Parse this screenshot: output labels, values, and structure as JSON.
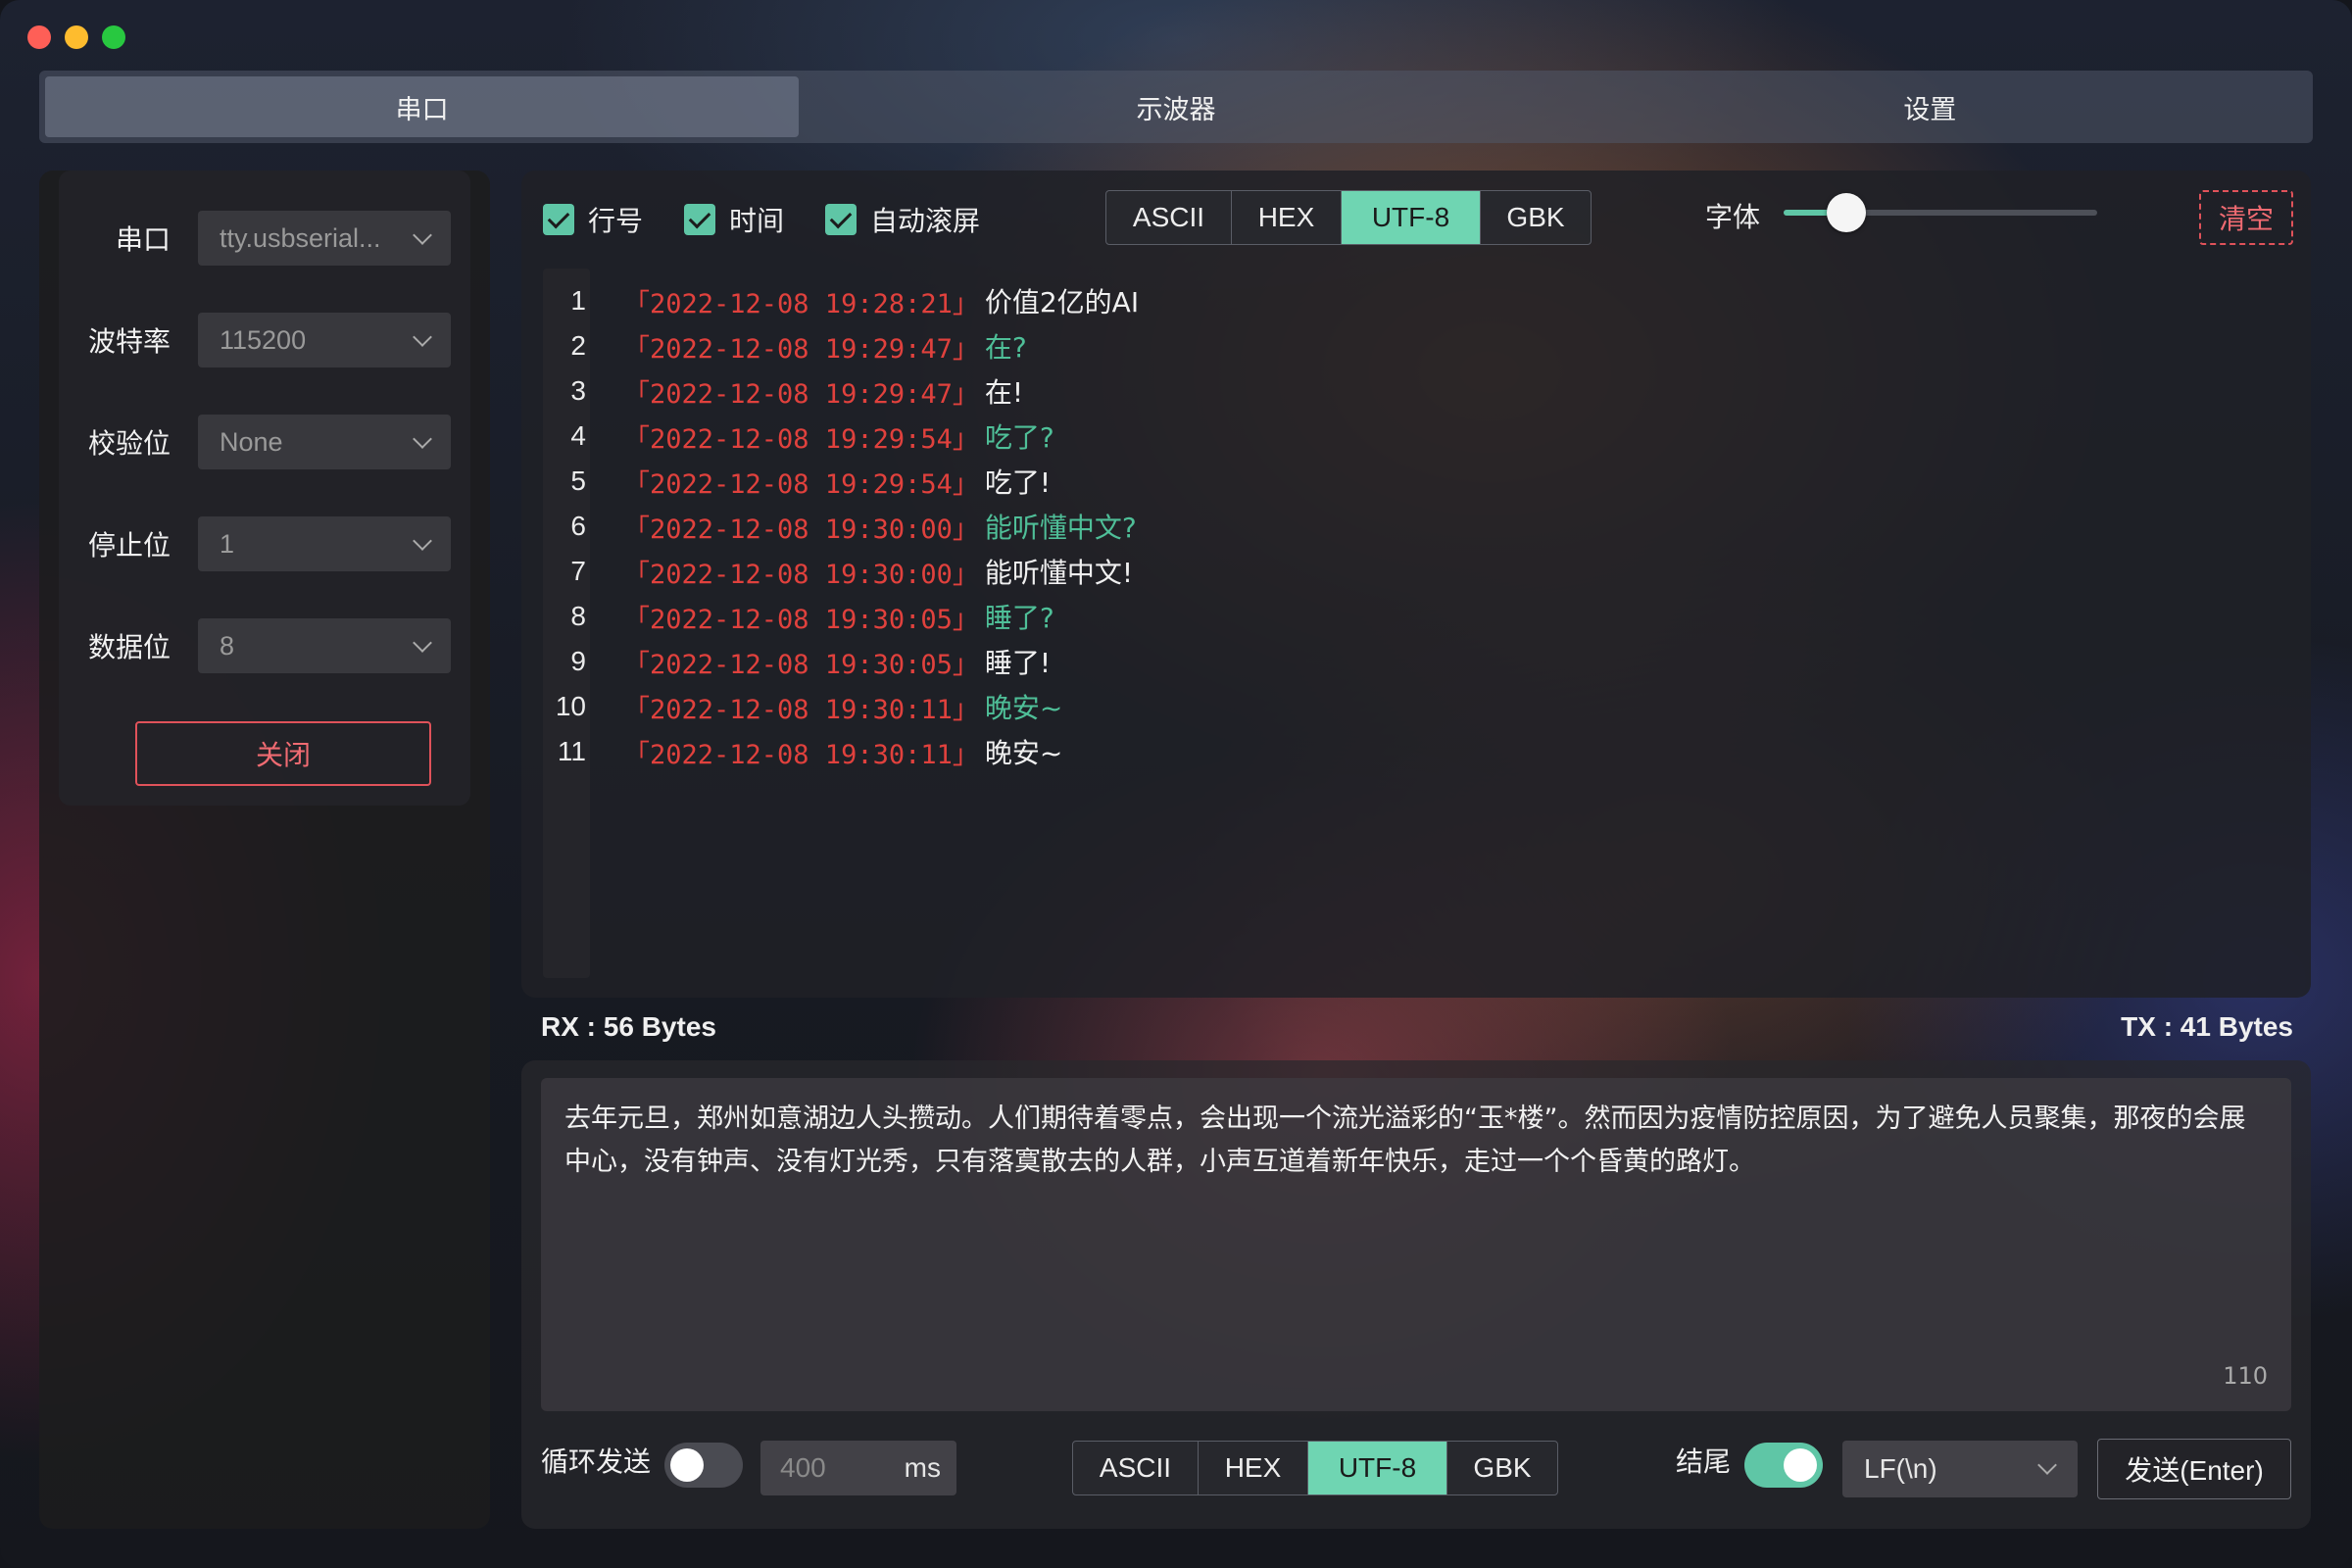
{
  "tabs": [
    {
      "label": "串口",
      "active": true
    },
    {
      "label": "示波器",
      "active": false
    },
    {
      "label": "设置",
      "active": false
    }
  ],
  "serial_config": {
    "fields": [
      {
        "label": "串口",
        "value": "tty.usbserial..."
      },
      {
        "label": "波特率",
        "value": "115200"
      },
      {
        "label": "校验位",
        "value": "None"
      },
      {
        "label": "停止位",
        "value": "1"
      },
      {
        "label": "数据位",
        "value": "8"
      }
    ],
    "close_label": "关闭"
  },
  "rx": {
    "checkboxes": [
      {
        "label": "行号",
        "checked": true
      },
      {
        "label": "时间",
        "checked": true
      },
      {
        "label": "自动滚屏",
        "checked": true
      }
    ],
    "encodings": [
      "ASCII",
      "HEX",
      "UTF-8",
      "GBK"
    ],
    "selected_encoding": "UTF-8",
    "font_label": "字体",
    "font_size_fraction": 0.2,
    "clear_label": "清空",
    "lines": [
      {
        "n": "1",
        "time": "「2022-12-08 19:28:21」",
        "text": "价值2亿的AI",
        "dir": "rx"
      },
      {
        "n": "2",
        "time": "「2022-12-08 19:29:47」",
        "text": "在?",
        "dir": "tx"
      },
      {
        "n": "3",
        "time": "「2022-12-08 19:29:47」",
        "text": "在!",
        "dir": "rx"
      },
      {
        "n": "4",
        "time": "「2022-12-08 19:29:54」",
        "text": "吃了?",
        "dir": "tx"
      },
      {
        "n": "5",
        "time": "「2022-12-08 19:29:54」",
        "text": "吃了!",
        "dir": "rx"
      },
      {
        "n": "6",
        "time": "「2022-12-08 19:30:00」",
        "text": "能听懂中文?",
        "dir": "tx"
      },
      {
        "n": "7",
        "time": "「2022-12-08 19:30:00」",
        "text": "能听懂中文!",
        "dir": "rx"
      },
      {
        "n": "8",
        "time": "「2022-12-08 19:30:05」",
        "text": "睡了?",
        "dir": "tx"
      },
      {
        "n": "9",
        "time": "「2022-12-08 19:30:05」",
        "text": "睡了!",
        "dir": "rx"
      },
      {
        "n": "10",
        "time": "「2022-12-08 19:30:11」",
        "text": "晚安~",
        "dir": "tx"
      },
      {
        "n": "11",
        "time": "「2022-12-08 19:30:11」",
        "text": "晚安~",
        "dir": "rx"
      }
    ]
  },
  "counters": {
    "rx": "RX : 56 Bytes",
    "tx": "TX : 41 Bytes"
  },
  "tx": {
    "text": "去年元旦，郑州如意湖边人头攒动。人们期待着零点，会出现一个流光溢彩的“玉*楼”。然而因为疫情防控原因，为了避免人员聚集，那夜的会展中心，没有钟声、没有灯光秀，只有落寞散去的人群，小声互道着新年快乐，走过一个个昏黄的路灯。",
    "char_count": "110",
    "loop_label": "循环发送",
    "loop_on": false,
    "interval_placeholder": "400",
    "interval_unit": "ms",
    "encodings": [
      "ASCII",
      "HEX",
      "UTF-8",
      "GBK"
    ],
    "selected_encoding": "UTF-8",
    "ending_label": "结尾",
    "ending_on": true,
    "ending_value": "LF(\\n)",
    "send_label": "发送(Enter)"
  },
  "colors": {
    "accent": "#6fd5b2",
    "danger": "#e0525a",
    "timestamp": "#e0413d",
    "tx_text": "#4fbf98"
  }
}
